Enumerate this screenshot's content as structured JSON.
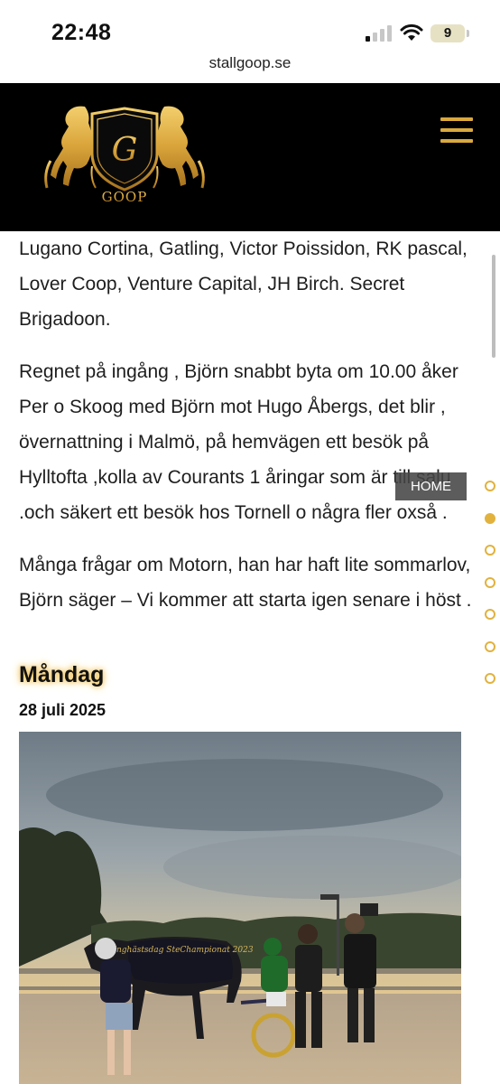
{
  "status_bar": {
    "time": "22:48",
    "battery": "9"
  },
  "browser": {
    "url": "stallgoop.se"
  },
  "header": {
    "logo_letter": "G",
    "logo_text": "GOOP",
    "accent_color": "#d9a93f"
  },
  "article": {
    "paragraphs": [
      [
        "Lugano Cortina, Gatling, Victor Poissidon, RK pascal,",
        "Lover Coop, Venture Capital, JH Birch. Secret",
        "Brigadoon."
      ],
      [
        "Regnet på ingång , Björn snabbt byta om 10.00 åker",
        "Per o Skoog med Björn mot Hugo Åbergs, det blir ,",
        "övernattning i Malmö, på hemvägen ett besök på",
        "Hylltofta ,kolla av Courants 1 åringar som är till salu",
        ".och säkert ett besök hos Tornell o några fler oxså ."
      ],
      [
        "Många frågar om Motorn, han har haft lite sommarlov,",
        "Björn säger – Vi kommer att starta igen senare i höst ."
      ]
    ]
  },
  "post": {
    "day": "Måndag",
    "date": "28 juli 2025",
    "blanket_text": "Unghästsdag SteChampionat 2023"
  },
  "side_nav": {
    "home_label": "HOME",
    "dot_count": 7,
    "active_index": 1
  }
}
